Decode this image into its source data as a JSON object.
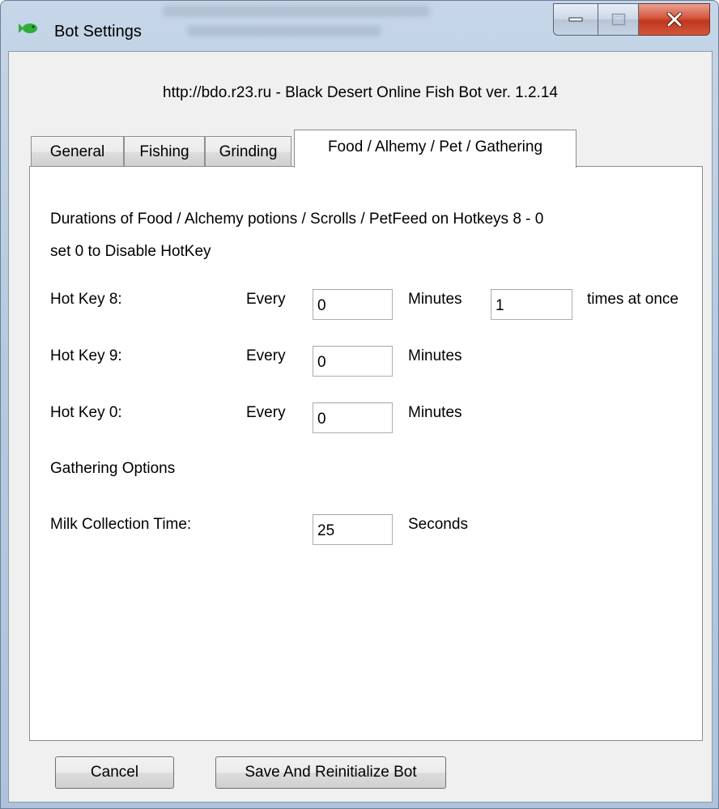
{
  "window": {
    "title": "Bot Settings",
    "header": "http://bdo.r23.ru - Black Desert Online Fish Bot ver. 1.2.14"
  },
  "tabs": [
    {
      "label": "General"
    },
    {
      "label": "Fishing"
    },
    {
      "label": "Grinding"
    },
    {
      "label": "Food / Alhemy / Pet / Gathering"
    }
  ],
  "active_tab": "Food / Alhemy / Pet / Gathering",
  "panel": {
    "description_line1": "Durations of Food / Alchemy potions / Scrolls / PetFeed on Hotkeys 8 - 0",
    "description_line2": "set 0 to Disable HotKey",
    "hotkeys": [
      {
        "label": "Hot Key 8:",
        "every": "Every",
        "value": "0",
        "unit": "Minutes",
        "times_value": "1",
        "times_label": "times at once"
      },
      {
        "label": "Hot Key 9:",
        "every": "Every",
        "value": "0",
        "unit": "Minutes"
      },
      {
        "label": "Hot Key 0:",
        "every": "Every",
        "value": "0",
        "unit": "Minutes"
      }
    ],
    "gathering_title": "Gathering Options",
    "milk_label": "Milk Collection Time:",
    "milk_value": "25",
    "milk_unit": "Seconds"
  },
  "buttons": {
    "cancel": "Cancel",
    "save": "Save And Reinitialize Bot"
  },
  "colors": {
    "frame": "#b7cadf",
    "client_bg": "#f0f0f0",
    "close_button": "#c0361d",
    "fish_icon": "#2fae3a"
  }
}
